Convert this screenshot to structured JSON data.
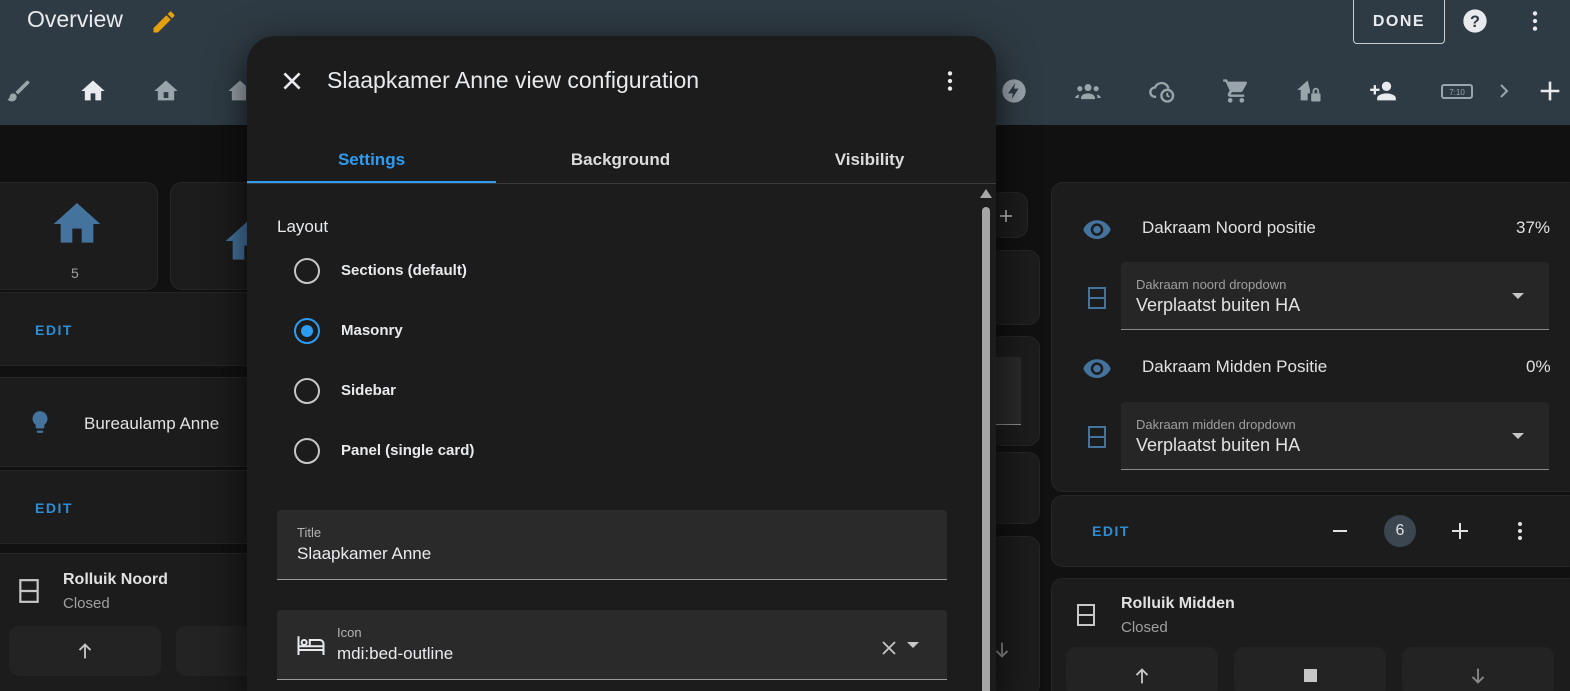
{
  "header": {
    "title": "Overview",
    "done_label": "DONE",
    "accent_color": "#e5a00d"
  },
  "view_tabs": [
    {
      "icon": "paint-brush-icon"
    },
    {
      "icon": "home-icon"
    },
    {
      "icon": "home-outline-icon"
    },
    {
      "icon": "home-g-icon"
    },
    {
      "icon": "flash-icon"
    },
    {
      "icon": "account-group-icon"
    },
    {
      "icon": "weather-cloudy-clock-icon"
    },
    {
      "icon": "cart-icon"
    },
    {
      "icon": "home-lock-icon"
    },
    {
      "icon": "account-plus-icon"
    },
    {
      "icon": "clock-digital-icon"
    },
    {
      "icon": "chevron-right-icon"
    },
    {
      "icon": "plus-icon"
    }
  ],
  "dialog": {
    "title": "Slaapkamer Anne view configuration",
    "tabs": [
      "Settings",
      "Background",
      "Visibility"
    ],
    "active_tab": "Settings",
    "layout_label": "Layout",
    "layouts": [
      {
        "label": "Sections (default)",
        "selected": false
      },
      {
        "label": "Masonry",
        "selected": true
      },
      {
        "label": "Sidebar",
        "selected": false
      },
      {
        "label": "Panel (single card)",
        "selected": false
      }
    ],
    "title_field": {
      "label": "Title",
      "value": "Slaapkamer Anne"
    },
    "icon_field": {
      "label": "Icon",
      "value": "mdi:bed-outline"
    }
  },
  "left_cards": {
    "home_count": "5",
    "edit_label": "EDIT",
    "lamp_name": "Bureaulamp Anne",
    "cover_name": "Rolluik Noord",
    "cover_state": "Closed"
  },
  "right_cards": {
    "entities": [
      {
        "name": "Dakraam Noord positie",
        "value": "37%"
      },
      {
        "name": "Dakraam Midden Positie",
        "value": "0%"
      }
    ],
    "selects": [
      {
        "label": "Dakraam noord dropdown",
        "value": "Verplaatst buiten HA"
      },
      {
        "label": "Dakraam midden dropdown",
        "value": "Verplaatst buiten HA"
      }
    ],
    "edit_label": "EDIT",
    "column_count": "6",
    "cover_name": "Rolluik Midden",
    "cover_state": "Closed"
  }
}
